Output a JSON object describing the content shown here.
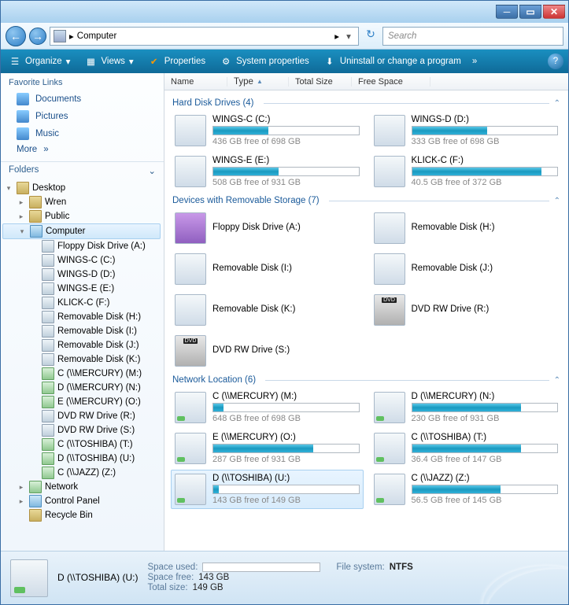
{
  "address": {
    "location": "Computer",
    "search_placeholder": "Search"
  },
  "toolbar": {
    "organize": "Organize",
    "views": "Views",
    "properties": "Properties",
    "system_properties": "System properties",
    "uninstall": "Uninstall or change a program"
  },
  "left": {
    "favorites_header": "Favorite Links",
    "favorites": [
      "Documents",
      "Pictures",
      "Music"
    ],
    "more": "More",
    "folders_header": "Folders",
    "tree": {
      "desktop": "Desktop",
      "user": "Wren",
      "public": "Public",
      "computer": "Computer",
      "computer_children": [
        "Floppy Disk Drive (A:)",
        "WINGS-C (C:)",
        "WINGS-D (D:)",
        "WINGS-E (E:)",
        "KLICK-C (F:)",
        "Removable Disk (H:)",
        "Removable Disk (I:)",
        "Removable Disk (J:)",
        "Removable Disk (K:)",
        "C (\\\\MERCURY) (M:)",
        "D (\\\\MERCURY) (N:)",
        "E (\\\\MERCURY) (O:)",
        "DVD RW Drive (R:)",
        "DVD RW Drive (S:)",
        "C (\\\\TOSHIBA) (T:)",
        "D (\\\\TOSHIBA) (U:)",
        "C (\\\\JAZZ) (Z:)"
      ],
      "network": "Network",
      "control_panel": "Control Panel",
      "recycle_bin": "Recycle Bin"
    }
  },
  "columns": {
    "name": "Name",
    "type": "Type",
    "total": "Total Size",
    "free": "Free Space"
  },
  "groups": [
    {
      "title": "Hard Disk Drives (4)",
      "kind": "hdd",
      "items": [
        {
          "name": "WINGS-C (C:)",
          "free": "436 GB free of 698 GB",
          "pct": 38
        },
        {
          "name": "WINGS-D (D:)",
          "free": "333 GB free of 698 GB",
          "pct": 52
        },
        {
          "name": "WINGS-E (E:)",
          "free": "508 GB free of 931 GB",
          "pct": 45
        },
        {
          "name": "KLICK-C (F:)",
          "free": "40.5 GB free of 372 GB",
          "pct": 89
        }
      ]
    },
    {
      "title": "Devices with Removable Storage (7)",
      "kind": "rem",
      "items": [
        {
          "name": "Floppy Disk Drive (A:)",
          "icon": "floppy"
        },
        {
          "name": "Removable Disk (H:)"
        },
        {
          "name": "Removable Disk (I:)"
        },
        {
          "name": "Removable Disk (J:)"
        },
        {
          "name": "Removable Disk (K:)"
        },
        {
          "name": "DVD RW Drive (R:)",
          "icon": "dvd"
        },
        {
          "name": "DVD RW Drive (S:)",
          "icon": "dvd"
        }
      ]
    },
    {
      "title": "Network Location (6)",
      "kind": "net",
      "items": [
        {
          "name": "C (\\\\MERCURY) (M:)",
          "free": "648 GB free of 698 GB",
          "pct": 7
        },
        {
          "name": "D (\\\\MERCURY) (N:)",
          "free": "230 GB free of 931 GB",
          "pct": 75
        },
        {
          "name": "E (\\\\MERCURY) (O:)",
          "free": "287 GB free of 931 GB",
          "pct": 69
        },
        {
          "name": "C (\\\\TOSHIBA) (T:)",
          "free": "36.4 GB free of 147 GB",
          "pct": 75
        },
        {
          "name": "D (\\\\TOSHIBA) (U:)",
          "free": "143 GB free of 149 GB",
          "pct": 4,
          "selected": true
        },
        {
          "name": "C (\\\\JAZZ) (Z:)",
          "free": "56.5 GB free of 145 GB",
          "pct": 61
        }
      ]
    }
  ],
  "details": {
    "name": "D (\\\\TOSHIBA) (U:)",
    "space_used_label": "Space used:",
    "space_free_label": "Space free:",
    "space_free": "143 GB",
    "total_label": "Total size:",
    "total": "149 GB",
    "fs_label": "File system:",
    "fs": "NTFS",
    "used_pct": 4
  }
}
